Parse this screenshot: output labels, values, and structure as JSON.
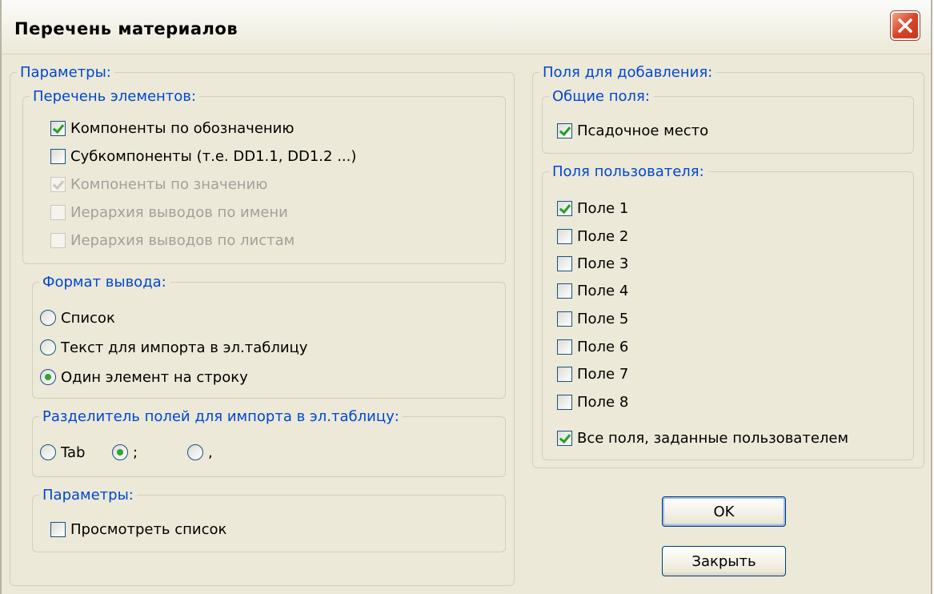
{
  "window": {
    "title": "Перечень материалов"
  },
  "params": {
    "legend": "Параметры:",
    "elements": {
      "legend": "Перечень элементов:",
      "items": [
        {
          "label": "Компоненты по обозначению",
          "checked": true,
          "disabled": false
        },
        {
          "label": "Субкомпоненты (т.е. DD1.1, DD1.2 ...)",
          "checked": false,
          "disabled": false
        },
        {
          "label": "Компоненты по значению",
          "checked": true,
          "disabled": true
        },
        {
          "label": "Иерархия выводов по имени",
          "checked": false,
          "disabled": true
        },
        {
          "label": "Иерархия выводов по листам",
          "checked": false,
          "disabled": true
        }
      ]
    },
    "format": {
      "legend": "Формат вывода:",
      "options": [
        {
          "label": "Список",
          "selected": false
        },
        {
          "label": "Текст для импорта в эл.таблицу",
          "selected": false
        },
        {
          "label": "Один элемент на строку",
          "selected": true
        }
      ]
    },
    "separator": {
      "legend": "Разделитель полей для импорта в эл.таблицу:",
      "options": [
        {
          "label": "Tab",
          "selected": false
        },
        {
          "label": ";",
          "selected": true
        },
        {
          "label": ",",
          "selected": false
        }
      ]
    },
    "params2": {
      "legend": "Параметры:",
      "preview": {
        "label": "Просмотреть список",
        "checked": false
      }
    }
  },
  "fields": {
    "legend": "Поля для добавления:",
    "common": {
      "legend": "Общие поля:",
      "footprint": {
        "label": "Псадочное место",
        "checked": true
      }
    },
    "user": {
      "legend": "Поля пользователя:",
      "items": [
        {
          "label": "Поле 1",
          "checked": true
        },
        {
          "label": "Поле 2",
          "checked": false
        },
        {
          "label": "Поле 3",
          "checked": false
        },
        {
          "label": "Поле 4",
          "checked": false
        },
        {
          "label": "Поле 5",
          "checked": false
        },
        {
          "label": "Поле 6",
          "checked": false
        },
        {
          "label": "Поле 7",
          "checked": false
        },
        {
          "label": "Поле 8",
          "checked": false
        }
      ],
      "all": {
        "label": "Все поля, заданные пользователем",
        "checked": true
      }
    }
  },
  "buttons": {
    "ok": "OK",
    "close": "Закрыть"
  }
}
